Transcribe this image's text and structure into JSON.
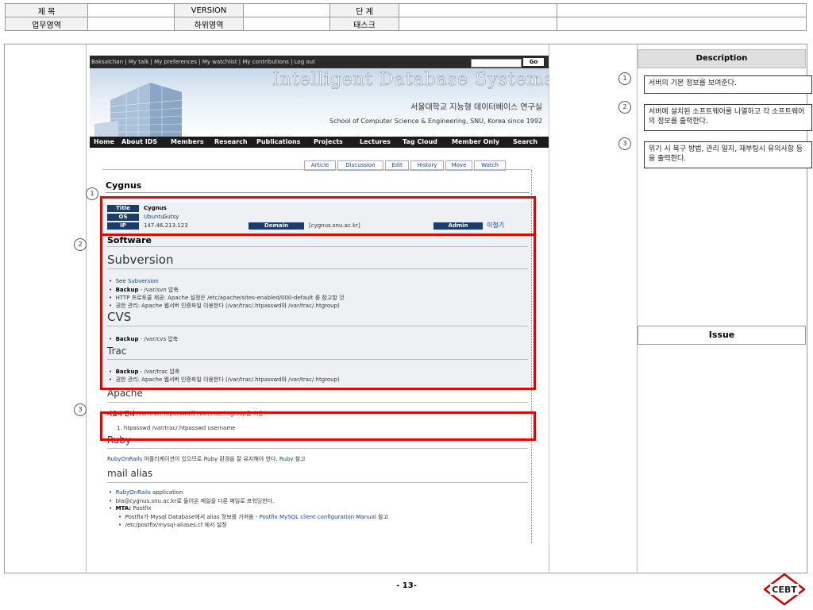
{
  "header": {
    "title_label": "제 목",
    "title_value": "",
    "version_label": "VERSION",
    "version_value": "",
    "stage_label": "단 계",
    "stage_value": "",
    "area_label": "업무영역",
    "area_value": "",
    "subarea_label": "하위영역",
    "subarea_value": "",
    "task_label": "태스크",
    "task_value": ""
  },
  "wiki": {
    "userbar": "Baksalchan | My talk | My preferences | My watchlist | My contributions | Log out",
    "go_label": "Go",
    "lab_title": "Intelligent Database Systems Lab.",
    "lab_korean": "서울대학교 지능형 데이터베이스 연구실",
    "lab_english": "School of Computer Science & Engineering, SNU, Korea since 1992",
    "nav": [
      "Home",
      "About IDS",
      "Members",
      "Research",
      "Publications",
      "Projects",
      "Lectures",
      "Tag Cloud",
      "Member Only",
      "Search"
    ],
    "tabs": [
      "Article",
      "Discussion",
      "Edit",
      "History",
      "Move",
      "Watch"
    ],
    "page_title": "Cygnus",
    "info": {
      "title_tag": "Title",
      "title_value": "Cygnus",
      "os_tag": "OS",
      "os_link": "Ubuntu",
      "os_rest": "Gutsy",
      "ip_tag": "IP",
      "ip_value": "147.46.213.123",
      "domain_tag": "Domain",
      "domain_value": "[cygnus.snu.ac.kr]",
      "admin_tag": "Admin",
      "admin_value": "이철기"
    },
    "software_heading": "Software",
    "subversion_heading": "Subversion",
    "subversion_items": [
      {
        "pre": "See ",
        "link": "Subversion",
        "post": ""
      },
      {
        "bold": "Backup",
        "text": " - /var/svn 압축"
      },
      {
        "text": "HTTP 프로토콜 제공: Apache 설정은 /etc/apache/sites-enabled/000-default 를 참고할 것"
      },
      {
        "text": "권한 관리: Apache 웹서버 인증파일 이용한다 (/var/trac/.htpasswd와 /var/trac/.htgroup)"
      }
    ],
    "cvs_heading": "CVS",
    "cvs_items": [
      {
        "bold": "Backup",
        "text": " - /var/cvs 압축"
      }
    ],
    "trac_heading": "Trac",
    "trac_items": [
      {
        "bold": "Backup",
        "text": " - /var/trac 압축"
      },
      {
        "text": "권한 관리: Apache 웹서버 인증파일 이용한다 (/var/trac/.htpasswd와 /var/trac/.htgroup)"
      }
    ],
    "apache_heading": "Apache",
    "user_mgmt_bold": "사용자 관리",
    "user_mgmt_text": " /var/trac/.htpasswd와 /var/trac/.htgroup을 이용",
    "user_mgmt_step": "1.   htpasswd /var/trac/.htpasswd username",
    "ruby_heading": "Ruby",
    "ruby_line_link": "RubyOnRails",
    "ruby_line_text": " 어플리케이션이 있으므로 Ruby 환경을 잘 유지해야 한다. ",
    "ruby_line_link2": "Ruby",
    "ruby_line_end": " 참고",
    "mail_heading": "mail alias",
    "mail_items": [
      {
        "link": "RubyOnRails",
        "text": " application"
      },
      {
        "text": "bla@cygnus.snu.ac.kr로 들어온 메일을 다른 메일로 포워딩한다."
      },
      {
        "bold": "MTA:",
        "text": " Postfix"
      }
    ],
    "mail_sub_items": [
      {
        "text": "Postfix가 Mysql Database에서 alias 정보를 가져옴 - ",
        "link": "Postfix MySQL client configuration Manual",
        "post": " 참고"
      },
      {
        "text": "/etc/postfix/mysql-aliases.cf 에서 설정"
      }
    ]
  },
  "callouts": [
    "1",
    "2",
    "3"
  ],
  "description": {
    "heading": "Description",
    "items": [
      "서버의 기본 정보를 보여준다.",
      "서버에 설치된 소프트웨어를 나열하고 각 소프트웨어의 정보를 출력한다.",
      "위기 시 복구 방법, 관리 일지, 재부팅시 유의사항 등을 출력한다."
    ]
  },
  "issue": {
    "heading": "Issue"
  },
  "page_number": "- 13-",
  "logo_text": "CEBT",
  "colors": {
    "highlight": "#e00000",
    "nav_bg": "#1c1c1c",
    "tag_bg": "#1a3d6e",
    "link": "#1144aa"
  }
}
